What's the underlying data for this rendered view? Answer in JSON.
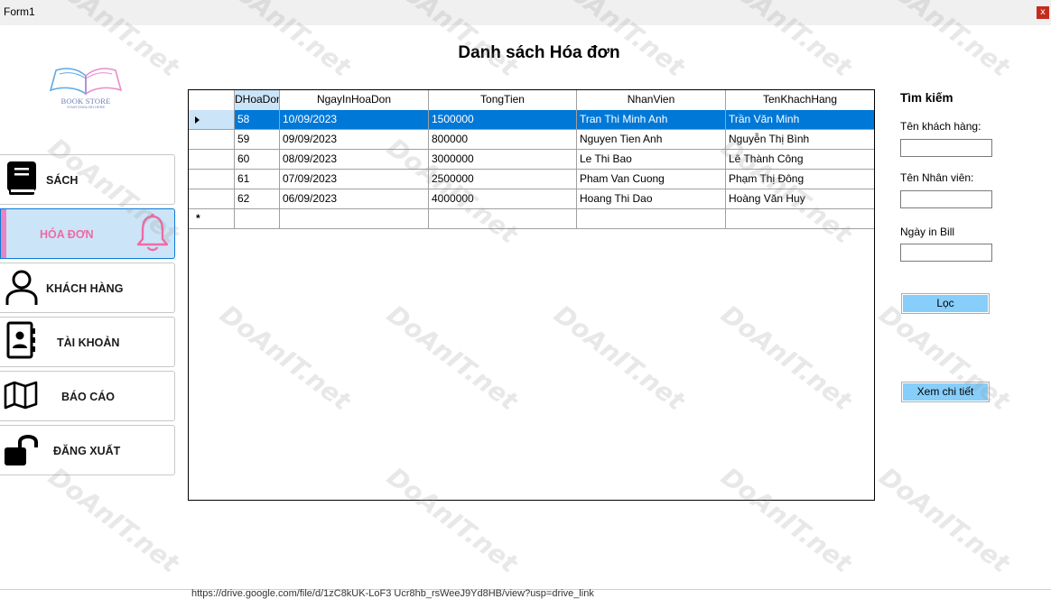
{
  "window": {
    "title": "Form1",
    "close_glyph": "x"
  },
  "page": {
    "title": "Danh sách Hóa đơn"
  },
  "logo": {
    "text": "BOOK STORE",
    "tagline": "YOUR ENGLISH HERE"
  },
  "nav": [
    {
      "label": "SÁCH",
      "icon": "book-icon"
    },
    {
      "label": "HÓA ĐƠN",
      "icon": "bell-icon",
      "active": true
    },
    {
      "label": "KHÁCH HÀNG",
      "icon": "user-icon"
    },
    {
      "label": "TÀI KHOẢN",
      "icon": "contact-book-icon"
    },
    {
      "label": "BÁO CÁO",
      "icon": "map-icon"
    },
    {
      "label": "ĐĂNG XUẤT",
      "icon": "unlock-icon"
    }
  ],
  "table": {
    "columns": [
      "DHoaDon",
      "NgayInHoaDon",
      "TongTien",
      "NhanVien",
      "TenKhachHang"
    ],
    "rows": [
      [
        "58",
        "10/09/2023",
        "1500000",
        "Tran Thi Minh Anh",
        "Trần Văn Minh"
      ],
      [
        "59",
        "09/09/2023",
        "800000",
        "Nguyen Tien Anh",
        "Nguyễn Thị Bình"
      ],
      [
        "60",
        "08/09/2023",
        "3000000",
        "Le Thi Bao",
        "Lê Thành Công"
      ],
      [
        "61",
        "07/09/2023",
        "2500000",
        "Pham Van Cuong",
        "Phạm Thị Đông"
      ],
      [
        "62",
        "06/09/2023",
        "4000000",
        "Hoang Thi Dao",
        "Hoàng Văn Huy"
      ]
    ],
    "selected_row": 0,
    "new_row_glyph": "*"
  },
  "search": {
    "title": "Tìm kiếm",
    "customer_label": "Tên khách hàng:",
    "customer_value": "",
    "employee_label": "Tên Nhân viên:",
    "employee_value": "",
    "date_label": "Ngày in Bill",
    "date_value": "",
    "filter_button": "Lọc",
    "detail_button": "Xem chi tiết"
  },
  "watermark": {
    "text": "DoAnIT.net"
  },
  "footer": {
    "text": "https://drive.google.com/file/d/1zC8kUK-LoF3 Ucr8hb_rsWeeJ9Yd8HB/view?usp=drive_link"
  },
  "colors": {
    "selection": "#0078d7",
    "active_nav_bg": "#cce4f7",
    "accent_pink": "#ef6aa6",
    "button_bg": "#87cefa"
  }
}
